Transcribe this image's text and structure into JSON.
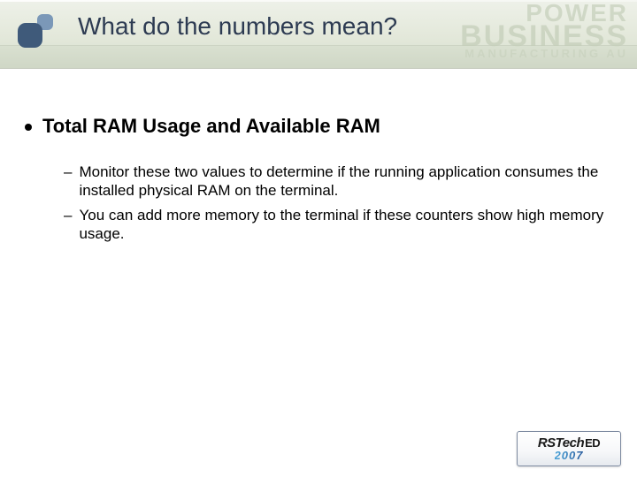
{
  "header": {
    "title": "What do the numbers mean?",
    "watermark": {
      "line1": "POWER",
      "line2": "BUSINESS",
      "line3": "MANUFACTURING AU"
    }
  },
  "body": {
    "bullet": "Total RAM Usage and Available RAM",
    "sub": [
      "Monitor these two values to determine if the running application consumes the installed physical RAM on the terminal.",
      "You can add more memory to the terminal if these counters show high memory usage."
    ]
  },
  "footer": {
    "brand_prefix": "RSTech",
    "brand_suffix": "ED",
    "year": "2007"
  }
}
